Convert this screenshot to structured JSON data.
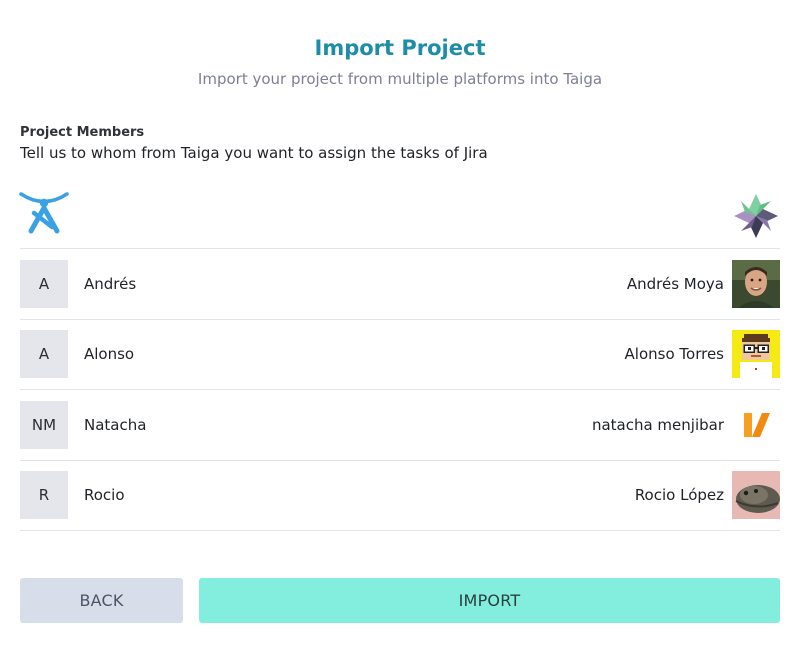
{
  "header": {
    "title": "Import Project",
    "subtitle": "Import your project from multiple platforms into Taiga"
  },
  "section": {
    "label": "Project Members",
    "description": "Tell us to whom from Taiga you want to assign the tasks of Jira"
  },
  "logos": {
    "source": "jira-logo-icon",
    "target": "taiga-logo-icon"
  },
  "members": [
    {
      "initials": "A",
      "jira_name": "Andrés",
      "taiga_name": "Andrés Moya",
      "avatar": "photo-avatar"
    },
    {
      "initials": "A",
      "jira_name": "Alonso",
      "taiga_name": "Alonso Torres",
      "avatar": "pixel-art-avatar"
    },
    {
      "initials": "NM",
      "jira_name": "Natacha",
      "taiga_name": "natacha menjibar",
      "avatar": "orange-n-logo-avatar"
    },
    {
      "initials": "R",
      "jira_name": "Rocio",
      "taiga_name": "Rocio López",
      "avatar": "turtle-photo-avatar"
    }
  ],
  "buttons": {
    "back": "BACK",
    "import": "IMPORT"
  },
  "colors": {
    "title": "#1d8da8",
    "subtitle": "#7d7f98",
    "back_button": "#d8dee9",
    "import_button": "#83eede",
    "initials_box": "#e4e6ec",
    "divider": "#e3e4e8"
  }
}
